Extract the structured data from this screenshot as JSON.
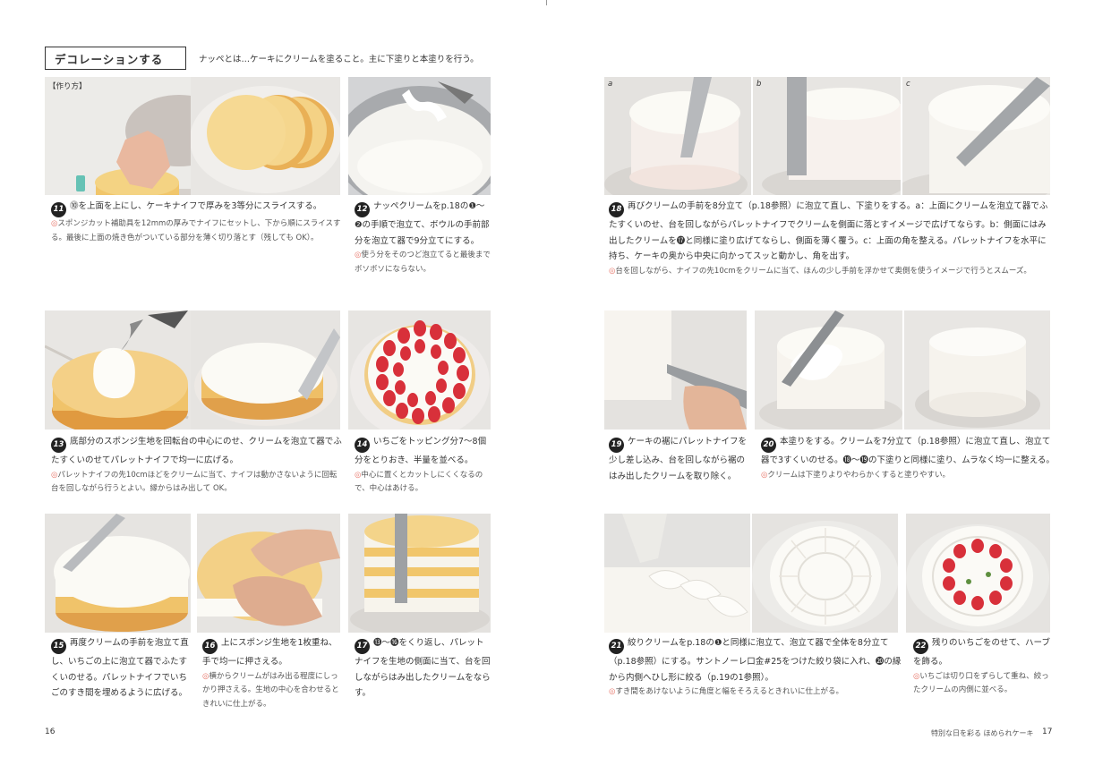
{
  "header": {
    "title": "デコレーションする",
    "description": "ナッペとは…ケーキにクリームを塗ること。主に下塗りと本塗りを行う。"
  },
  "labels": {
    "recipe_tag": "【作り方】",
    "a": "a",
    "b": "b",
    "c": "c",
    "tip_mark": "◎"
  },
  "steps": {
    "s11": {
      "num": "11",
      "text": "⓾を上面を上にし、ケーキナイフで厚みを3等分にスライスする。",
      "tip": "スポンジカット補助具を12mmの厚みでナイフにセットし、下から順にスライスする。最後に上面の焼き色がついている部分を薄く切り落とす（残しても OK）。"
    },
    "s12": {
      "num": "12",
      "text": "ナッペクリームをp.18の❶〜❷の手順で泡立て、ボウルの手前部分を泡立て器で9分立てにする。",
      "tip": "使う分をそのつど泡立てると最後までボソボソにならない。"
    },
    "s13": {
      "num": "13",
      "text": "底部分のスポンジ生地を回転台の中心にのせ、クリームを泡立て器でふたすくいのせてパレットナイフで均一に広げる。",
      "tip": "パレットナイフの先10cmほどをクリームに当て、ナイフは動かさないように回転台を回しながら行うとよい。縁からはみ出して OK。"
    },
    "s14": {
      "num": "14",
      "text": "いちごをトッピング分7〜8個分をとりおき、半量を並べる。",
      "tip": "中心に置くとカットしにくくなるので、中心はあける。"
    },
    "s15": {
      "num": "15",
      "text": "再度クリームの手前を泡立て直し、いちごの上に泡立て器でふたすくいのせる。パレットナイフでいちごのすき間を埋めるように広げる。",
      "tip": ""
    },
    "s16": {
      "num": "16",
      "text": "上にスポンジ生地を1枚重ね、手で均一に押さえる。",
      "tip": "横からクリームがはみ出る程度にしっかり押さえる。生地の中心を合わせるときれいに仕上がる。"
    },
    "s17": {
      "num": "17",
      "text": "⓭〜⓰をくり返し、パレットナイフを生地の側面に当て、台を回しながらはみ出したクリームをならす。",
      "tip": ""
    },
    "s18": {
      "num": "18",
      "text": "再びクリームの手前を8分立て（p.18参照）に泡立て直し、下塗りをする。a：上面にクリームを泡立て器でふたすくいのせ、台を回しながらパレットナイフでクリームを側面に落とすイメージで広げてならす。b：側面にはみ出したクリームを⓱と同様に塗り広げてならし、側面を薄く覆う。c：上面の角を整える。パレットナイフを水平に持ち、ケーキの奥から中央に向かってスッと動かし、角を出す。",
      "tip": "台を回しながら、ナイフの先10cmをクリームに当て、ほんの少し手前を浮かせて奥側を使うイメージで行うとスムーズ。"
    },
    "s19": {
      "num": "19",
      "text": "ケーキの裾にパレットナイフを少し差し込み、台を回しながら裾のはみ出したクリームを取り除く。",
      "tip": ""
    },
    "s20": {
      "num": "20",
      "text": "本塗りをする。クリームを7分立て（p.18参照）に泡立て直し、泡立て器で3すくいのせる。⓲〜⓳の下塗りと同様に塗り、ムラなく均一に整える。",
      "tip": "クリームは下塗りよりやわらかくすると塗りやすい。"
    },
    "s21": {
      "num": "21",
      "text": "絞りクリームをp.18の❶と同様に泡立て、泡立て器で全体を8分立て（p.18参照）にする。サントノーレ口金#25をつけた絞り袋に入れ、⓴の縁から内側へひし形に絞る（p.19の1参照）。",
      "tip": "すき間をあけないように角度と幅をそろえるときれいに仕上がる。"
    },
    "s22": {
      "num": "22",
      "text": "残りのいちごをのせて、ハーブを飾る。",
      "tip": "いちごは切り口をずらして重ね、絞ったクリームの内側に並べる。"
    }
  },
  "footer": {
    "left_page": "16",
    "right_page": "17",
    "running_title": "特別な日を彩る ほめられケーキ"
  },
  "colors": {
    "sponge": "#f0c36a",
    "cream": "#fbfaf5",
    "marble": "#e9e7e4",
    "strawberry": "#d8303a",
    "tip": "#e87a6e"
  }
}
